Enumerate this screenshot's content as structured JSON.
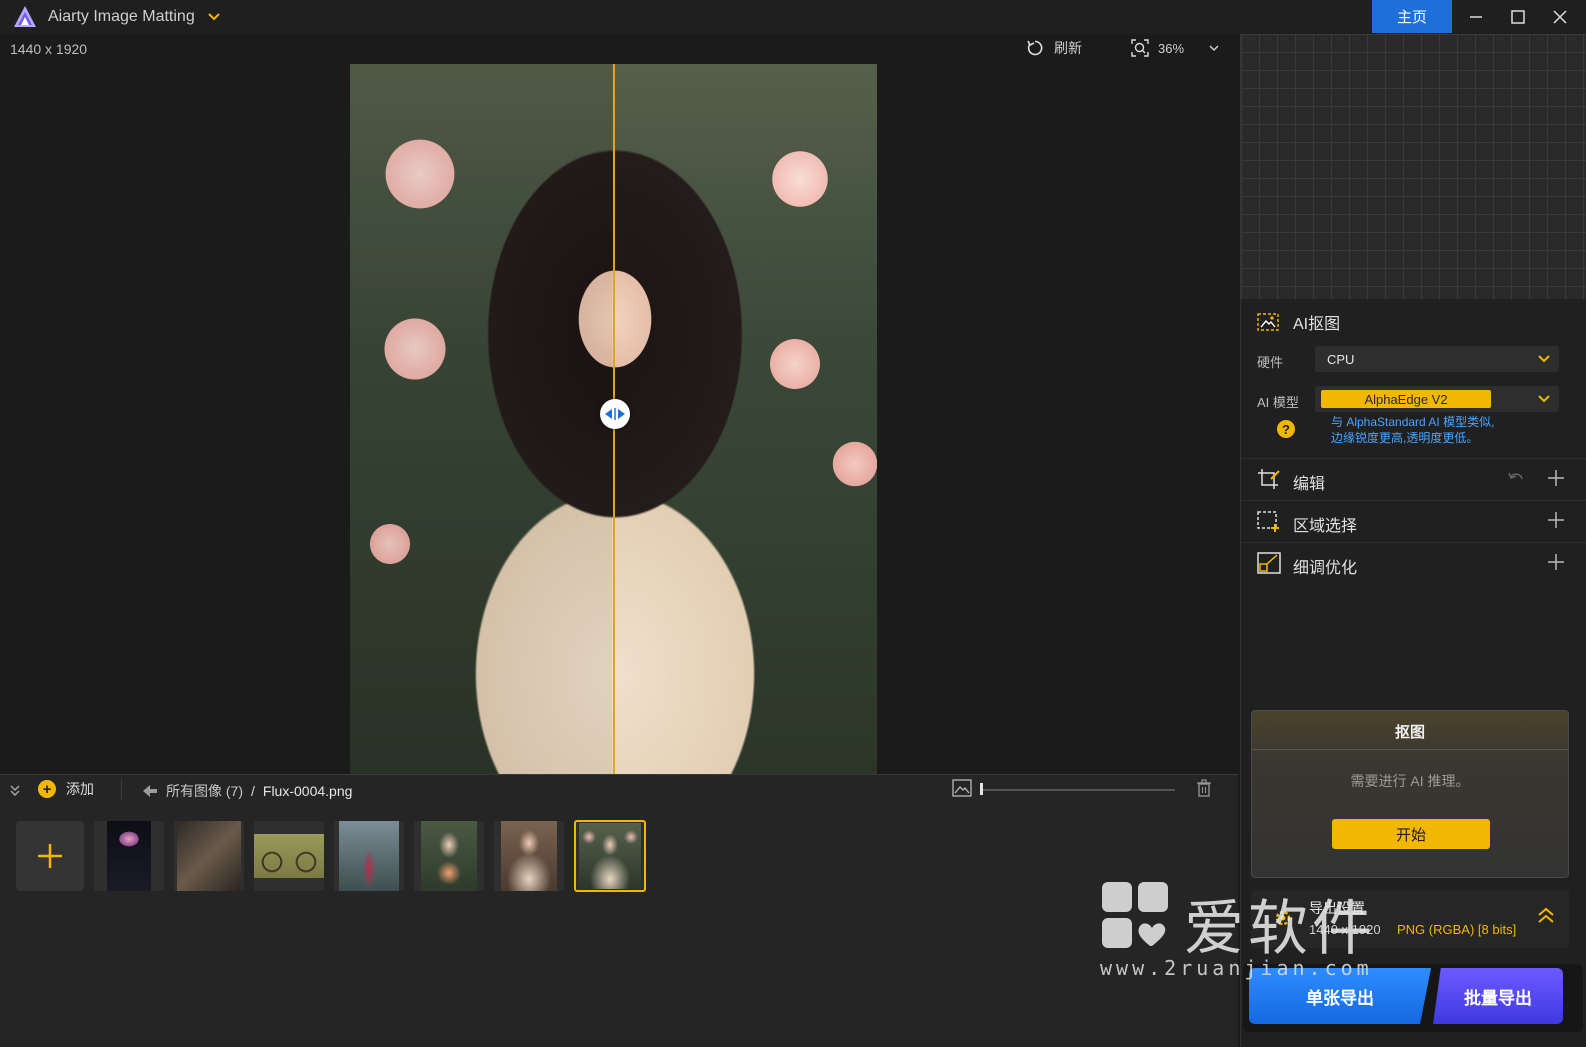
{
  "titlebar": {
    "app_title": "Aiarty Image Matting",
    "home_label": "主页"
  },
  "canvas": {
    "dimensions": "1440 x 1920",
    "refresh_label": "刷新",
    "zoom_value": "36%"
  },
  "strip": {
    "add_label": "添加",
    "all_images": "所有图像 (7)",
    "separator": "/",
    "current_file": "Flux-0004.png",
    "thumbnails": [
      {
        "name": "jellyfish",
        "color": "#1a1a2a"
      },
      {
        "name": "rock-sculpture",
        "color": "#4a3a30"
      },
      {
        "name": "bicycle",
        "color": "#8c8a55"
      },
      {
        "name": "forest-woman",
        "color": "#5b6a6e"
      },
      {
        "name": "flower-bouquet-girl",
        "color": "#7a5a48"
      },
      {
        "name": "portrait-lady",
        "color": "#6a5546"
      },
      {
        "name": "flux-0004",
        "color": "#4a5442"
      }
    ]
  },
  "panel": {
    "ai_matting_title": "AI抠图",
    "hardware_label": "硬件",
    "hardware_value": "CPU",
    "model_label": "AI 模型",
    "model_value": "AlphaEdge  V2",
    "model_desc_line1": "与 AlphaStandard AI 模型类似,",
    "model_desc_line2": "边缘锐度更高,透明度更低。",
    "edit_label": "编辑",
    "region_label": "区域选择",
    "refine_label": "细调优化",
    "matting_card_title": "抠图",
    "matting_card_msg": "需要进行 AI 推理。",
    "start_label": "开始",
    "output_title": "导出设置",
    "output_size": "1440 x 1920",
    "output_format": "PNG (RGBA) [8 bits]",
    "single_export": "单张导出",
    "batch_export": "批量导出"
  },
  "watermark": {
    "text": "爱软件",
    "url": "www.2ruanjian.com"
  },
  "colors": {
    "accent": "#f2b705",
    "home_blue": "#1e6fd9",
    "link_blue": "#4aa3ff",
    "batch_purple": "#5a4bff"
  }
}
